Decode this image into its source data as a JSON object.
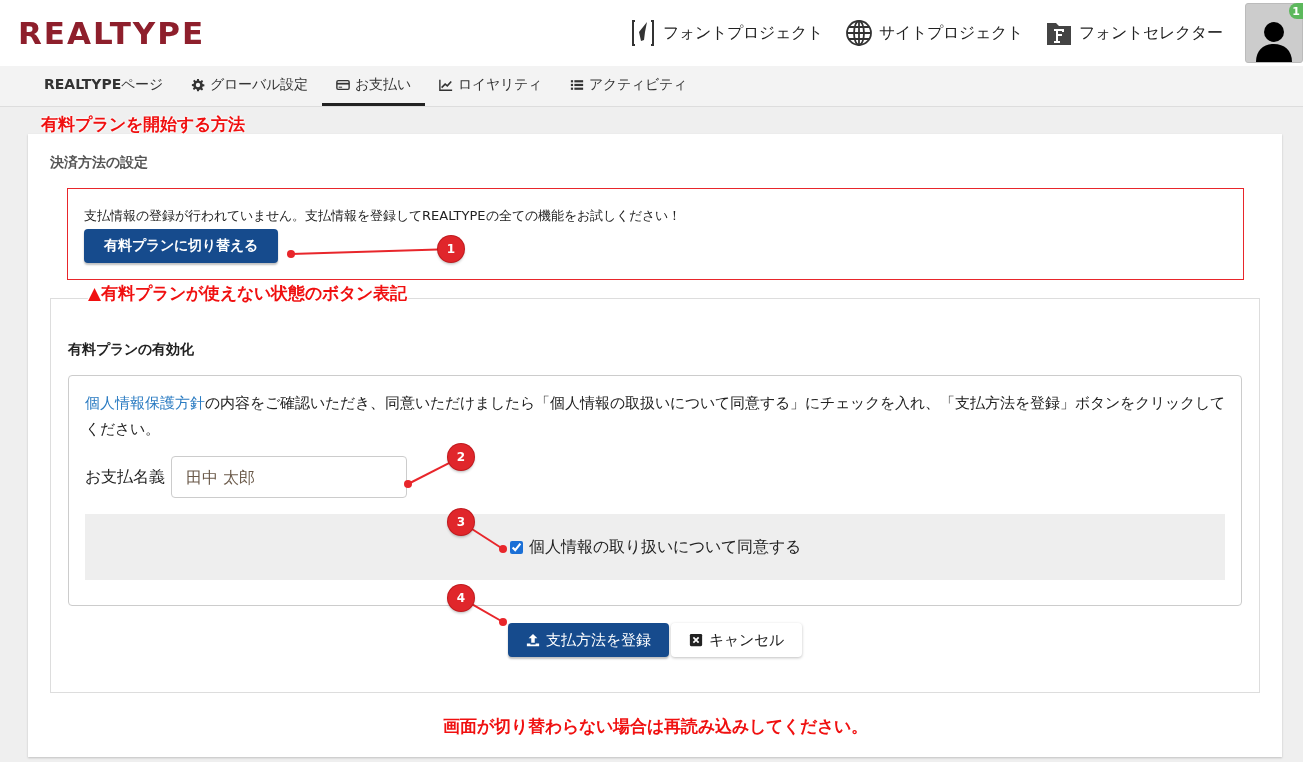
{
  "header": {
    "logo": "REALTYPE",
    "links": [
      {
        "label": "フォントプロジェクト"
      },
      {
        "label": "サイトプロジェクト"
      },
      {
        "label": "フォントセレクター"
      }
    ],
    "avatar_badge": "1"
  },
  "tabs": [
    {
      "label": "**REALTYPE**ページ",
      "selected": false
    },
    {
      "label": "グローバル設定",
      "selected": false
    },
    {
      "label": "お支払い",
      "selected": true
    },
    {
      "label": "ロイヤリティ",
      "selected": false
    },
    {
      "label": "アクティビティ",
      "selected": false
    }
  ],
  "annotation_title": "有料プランを開始する方法",
  "payment_settings": {
    "heading": "決済方法の設定",
    "alert": {
      "message": "支払情報の登録が行われていません。支払情報を登録してREALTYPEの全ての機能をお試しください！",
      "button": "有料プランに切り替える"
    },
    "caption": "▲有料プランが使えない状態のボタン表記"
  },
  "activation": {
    "heading": "有料プランの有効化",
    "notice": {
      "link": "個人情報保護方針",
      "text": "の内容をご確認いただき、同意いただけましたら「個人情報の取扱いについて同意する」にチェックを入れ、「支払方法を登録」ボタンをクリックしてください。"
    },
    "name_field": {
      "label": "お支払名義",
      "placeholder": "田中 太郎"
    },
    "consent": {
      "label": "個人情報の取り扱いについて同意する",
      "checked": true
    },
    "buttons": [
      {
        "label": "支払方法を登録",
        "kind": "primary"
      },
      {
        "label": "キャンセル",
        "kind": "default"
      }
    ]
  },
  "reload_note": "画面が切り替わらない場合は再読み込みしてください。",
  "callouts": [
    "1",
    "2",
    "3",
    "4"
  ]
}
